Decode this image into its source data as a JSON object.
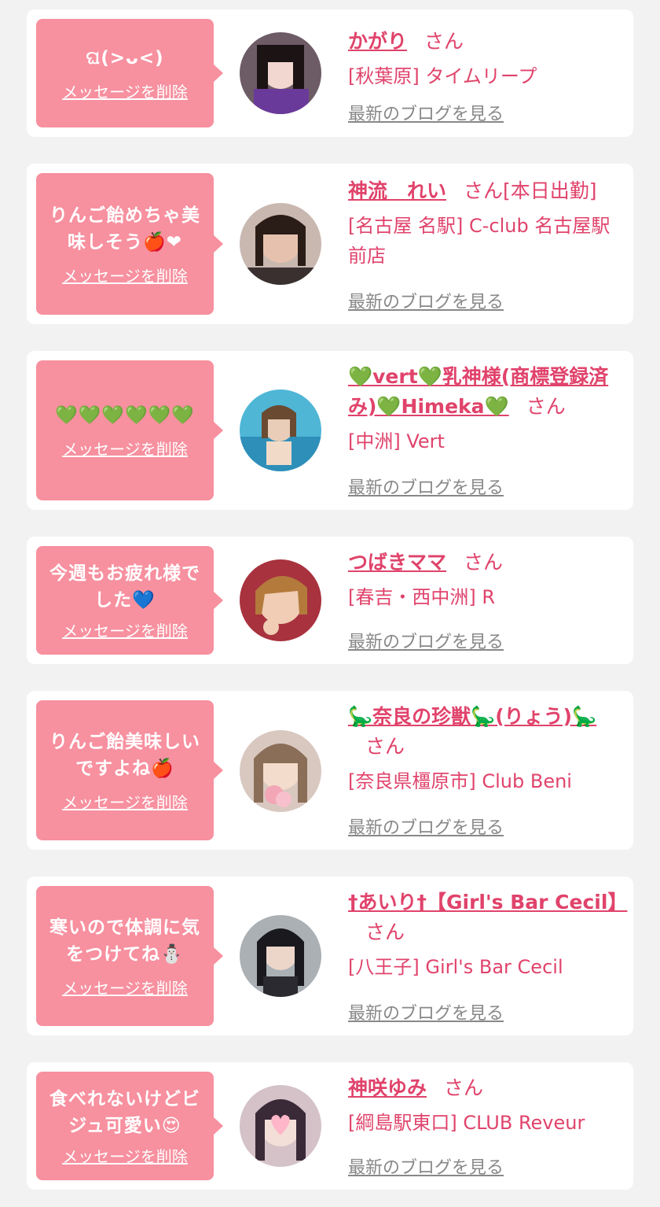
{
  "cards": [
    {
      "message": "ଘ(>ᴗ<)",
      "delete_label": "メッセージを削除",
      "name": "かがり",
      "honorific": "さん",
      "tag": "",
      "shop": "[秋葉原] タイムリープ",
      "blog_link": "最新のブログを見る"
    },
    {
      "message": "りんご飴めちゃ美味しそう🍎❤",
      "delete_label": "メッセージを削除",
      "name": "神流　れい",
      "honorific": "さん",
      "tag": "[本日出勤]",
      "shop": "[名古屋 名駅] C-club 名古屋駅前店",
      "blog_link": "最新のブログを見る"
    },
    {
      "message": "💚💚💚💚💚💚",
      "delete_label": "メッセージを削除",
      "name": "💚vert💚乳神様(商標登録済み)💚Himeka💚",
      "honorific": "さん",
      "tag": "",
      "shop": "[中洲] Vert",
      "blog_link": "最新のブログを見る"
    },
    {
      "message": "今週もお疲れ様でした💙",
      "delete_label": "メッセージを削除",
      "name": "つばきママ",
      "honorific": "さん",
      "tag": "",
      "shop": "[春吉・西中洲] R",
      "blog_link": "最新のブログを見る"
    },
    {
      "message": "りんご飴美味しいですよね🍎",
      "delete_label": "メッセージを削除",
      "name": "🦕奈良の珍獣🦕(りょう)🦕",
      "honorific": "さん",
      "tag": "",
      "shop": "[奈良県橿原市] Club Beni",
      "blog_link": "最新のブログを見る"
    },
    {
      "message": "寒いので体調に気をつけてね⛄",
      "delete_label": "メッセージを削除",
      "name": "†あいり†【Girl's Bar Cecil】",
      "honorific": "さん",
      "tag": "",
      "shop": "[八王子] Girl's Bar Cecil",
      "blog_link": "最新のブログを見る"
    },
    {
      "message": "食べれないけどビジュ可愛い😍",
      "delete_label": "メッセージを削除",
      "name": "神咲ゆみ",
      "honorific": "さん",
      "tag": "",
      "shop": "[綱島駅東口] CLUB Reveur",
      "blog_link": "最新のブログを見る"
    }
  ],
  "colors": {
    "bubble": "#f7909f",
    "accent": "#e0436b",
    "link_gray": "#888888",
    "background": "#f2f2f2"
  }
}
